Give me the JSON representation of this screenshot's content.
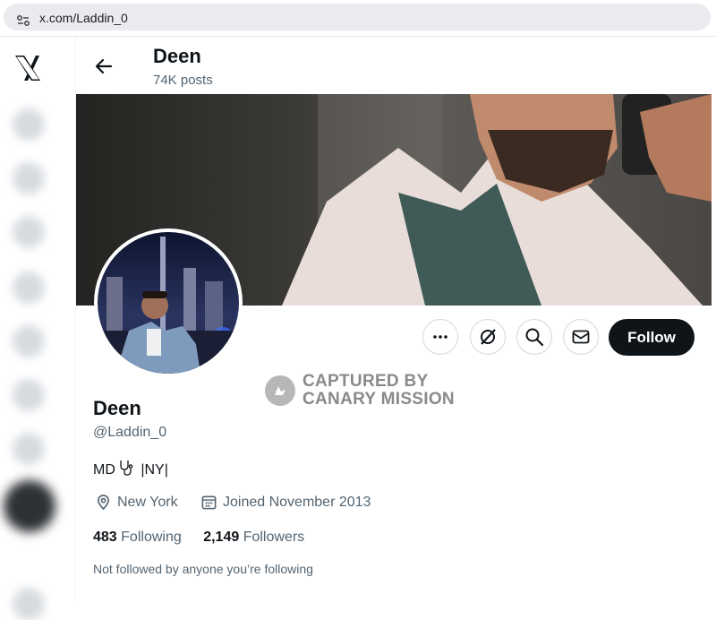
{
  "browser": {
    "url": "x.com/Laddin_0"
  },
  "header": {
    "name": "Deen",
    "posts": "74K posts"
  },
  "actions": {
    "follow_label": "Follow"
  },
  "watermark": {
    "line1": "CAPTURED BY",
    "line2": "CANARY MISSION"
  },
  "profile": {
    "name": "Deen",
    "handle": "@Laddin_0",
    "bio_prefix": "MD",
    "bio_suffix": "|NY|",
    "location": "New York",
    "joined": "Joined November 2013",
    "following_count": "483",
    "following_label": "Following",
    "followers_count": "2,149",
    "followers_label": "Followers",
    "not_followed_text": "Not followed by anyone you’re following"
  },
  "icons": {
    "back": "arrow-left-icon",
    "more": "more-icon",
    "grok": "grok-icon",
    "search": "search-icon",
    "message": "mail-icon",
    "location": "location-pin-icon",
    "calendar": "calendar-icon",
    "bio_emoji": "stethoscope-icon",
    "brand": "x-logo-icon"
  },
  "colors": {
    "follow_bg": "#0f1419",
    "secondary_text": "#536471",
    "border": "#cfd9de"
  }
}
